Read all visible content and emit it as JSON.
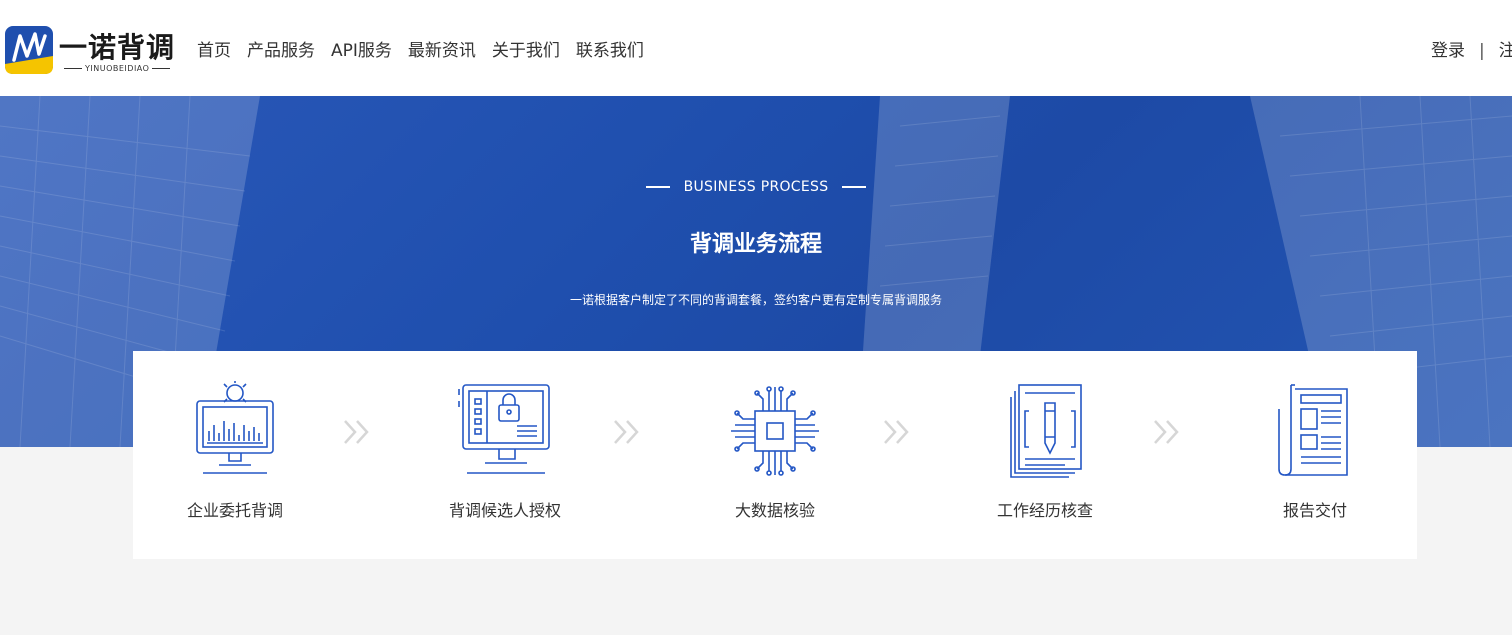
{
  "brand": {
    "name": "一诺背调",
    "sub": "YINUOBEIDIAO",
    "colors": {
      "blue": "#1f4fae",
      "yellow": "#f5c400"
    }
  },
  "nav": {
    "items": [
      {
        "label": "首页"
      },
      {
        "label": "产品服务"
      },
      {
        "label": "API服务"
      },
      {
        "label": "最新资讯"
      },
      {
        "label": "关于我们"
      },
      {
        "label": "联系我们"
      }
    ]
  },
  "auth": {
    "login": "登录",
    "separator": "|",
    "register": "注"
  },
  "banner": {
    "eyebrow": "BUSINESS PROCESS",
    "title": "背调业务流程",
    "subtitle": "一诺根据客户制定了不同的背调套餐，签约客户更有定制专属背调服务"
  },
  "steps": [
    {
      "label": "企业委托背调",
      "icon": "monitor-chart-icon"
    },
    {
      "label": "背调候选人授权",
      "icon": "monitor-lock-icon"
    },
    {
      "label": "大数据核验",
      "icon": "chip-circuit-icon"
    },
    {
      "label": "工作经历核查",
      "icon": "document-pen-icon"
    },
    {
      "label": "报告交付",
      "icon": "newspaper-icon"
    }
  ]
}
